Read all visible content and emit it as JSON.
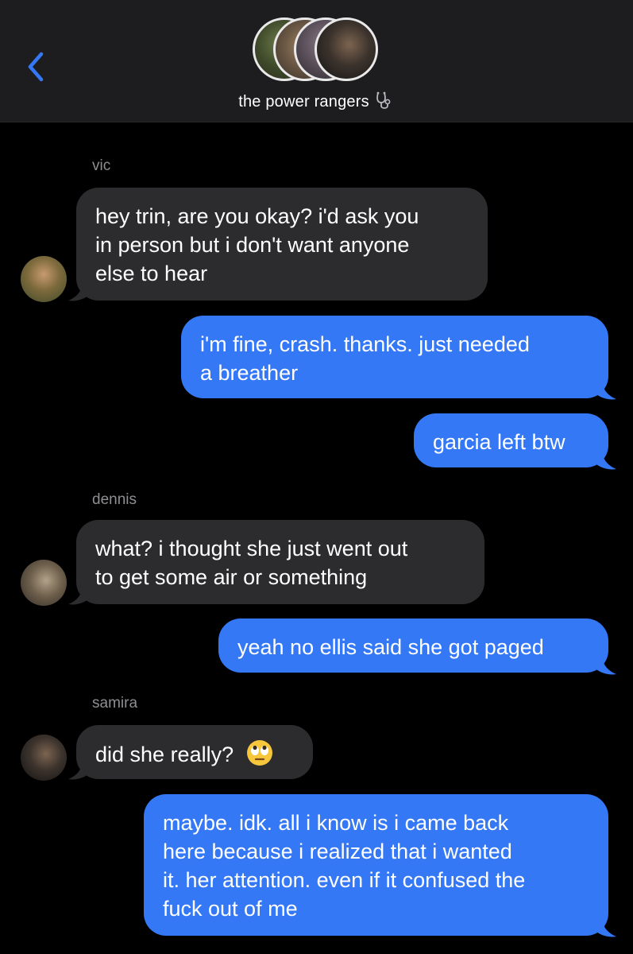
{
  "header": {
    "title": "the power rangers",
    "title_emoji": "stethoscope-emoji",
    "back_icon": "chevron-left-icon",
    "colors": {
      "bar": "#1d1d1f",
      "accent": "#3478f6"
    }
  },
  "messages": [
    {
      "type": "sender",
      "text": "vic"
    },
    {
      "type": "in",
      "lines": [
        "hey trin, are you okay? i'd ask you",
        "in person but i don't want anyone",
        "else to hear"
      ]
    },
    {
      "type": "out",
      "lines": [
        "i'm fine, crash. thanks. just needed",
        "a breather"
      ]
    },
    {
      "type": "out",
      "lines": [
        "garcia left btw"
      ]
    },
    {
      "type": "sender",
      "text": "dennis"
    },
    {
      "type": "in",
      "lines": [
        "what? i thought she just went out",
        "to get some air or something"
      ]
    },
    {
      "type": "out",
      "lines": [
        "yeah no ellis said she got paged"
      ]
    },
    {
      "type": "sender",
      "text": "samira"
    },
    {
      "type": "in",
      "lines": [
        "did she really?"
      ],
      "emoji": "eye-roll-emoji"
    },
    {
      "type": "out",
      "lines": [
        "maybe. idk. all i know is i came back",
        "here because i realized that i wanted",
        "it. her attention. even if it confused the",
        "fuck out of me"
      ]
    }
  ],
  "colors": {
    "incoming": "#2c2c2e",
    "outgoing": "#3478f6",
    "background": "#000000",
    "sender_label": "#8e8e93"
  }
}
